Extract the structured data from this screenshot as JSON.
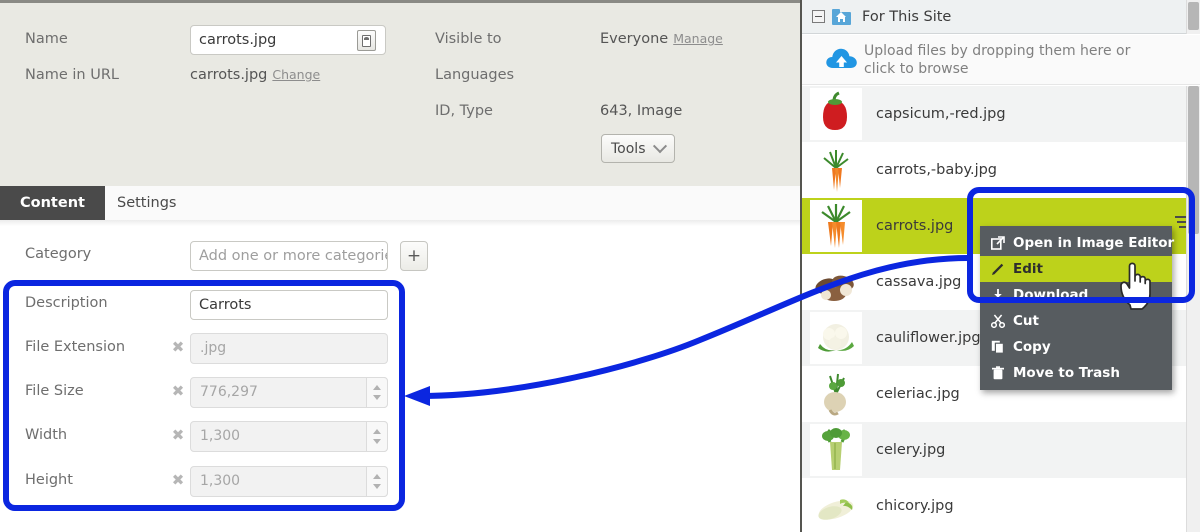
{
  "left": {
    "meta_fields": [
      {
        "label": "Name",
        "value": "carrots.jpg",
        "kind": "input"
      },
      {
        "label": "Name in URL",
        "value": "carrots.jpg",
        "kind": "static",
        "link": "Change"
      },
      {
        "label": "Visible to",
        "value": "Everyone",
        "kind": "static",
        "link": "Manage"
      },
      {
        "label": "Languages",
        "value": "",
        "kind": "static"
      },
      {
        "label": "ID, Type",
        "value": "643, Image",
        "kind": "static"
      }
    ],
    "tools_button": "Tools",
    "tabs": [
      {
        "label": "Content",
        "active": true
      },
      {
        "label": "Settings",
        "active": false
      }
    ],
    "content_fields": [
      {
        "label": "Category",
        "value": "Add one or more categories",
        "placeholder": "Add one or more categories",
        "ghost": true,
        "pin": false,
        "spin": false,
        "plus": true
      },
      {
        "label": "Description",
        "value": "Carrots",
        "placeholder": "",
        "ghost": false,
        "pin": false,
        "spin": false,
        "plus": false
      },
      {
        "label": "File Extension",
        "value": ".jpg",
        "placeholder": ".jpg",
        "ghost": true,
        "pin": true,
        "spin": false,
        "plus": false
      },
      {
        "label": "File Size",
        "value": "776,297",
        "placeholder": "776,297",
        "ghost": true,
        "pin": true,
        "spin": true,
        "plus": false
      },
      {
        "label": "Width",
        "value": "1,300",
        "placeholder": "1,300",
        "ghost": true,
        "pin": true,
        "spin": true,
        "plus": false
      },
      {
        "label": "Height",
        "value": "1,300",
        "placeholder": "1,300",
        "ghost": true,
        "pin": true,
        "spin": true,
        "plus": false
      }
    ]
  },
  "right": {
    "site_title": "For This Site",
    "upload_text": "Upload files by dropping them here or click to browse",
    "files": [
      {
        "name": "capsicum,-red.jpg",
        "thumb": "capsicum",
        "row": "alt",
        "selected": false
      },
      {
        "name": "carrots,-baby.jpg",
        "thumb": "carrots-baby",
        "row": "plain",
        "selected": false
      },
      {
        "name": "carrots.jpg",
        "thumb": "carrots",
        "row": "alt",
        "selected": true
      },
      {
        "name": "cassava.jpg",
        "thumb": "cassava",
        "row": "plain",
        "selected": false
      },
      {
        "name": "cauliflower.jpg",
        "thumb": "cauliflower",
        "row": "alt",
        "selected": false
      },
      {
        "name": "celeriac.jpg",
        "thumb": "celeriac",
        "row": "plain",
        "selected": false
      },
      {
        "name": "celery.jpg",
        "thumb": "celery",
        "row": "alt",
        "selected": false
      },
      {
        "name": "chicory.jpg",
        "thumb": "chicory",
        "row": "plain",
        "selected": false
      }
    ],
    "context_menu": [
      {
        "label": "Open in Image Editor",
        "icon": "external-link-icon",
        "highlighted": false
      },
      {
        "label": "Edit",
        "icon": "pencil-icon",
        "highlighted": true
      },
      {
        "label": "Download",
        "icon": "download-icon",
        "highlighted": false
      },
      {
        "label": "Cut",
        "icon": "scissors-icon",
        "highlighted": false
      },
      {
        "label": "Copy",
        "icon": "copy-icon",
        "highlighted": false
      },
      {
        "label": "Move to Trash",
        "icon": "trash-icon",
        "highlighted": false
      }
    ]
  },
  "colors": {
    "annotation": "#0b26e0",
    "selection": "#bdd21b",
    "tab_active": "#4a4a4a",
    "menu_bg": "#575c60",
    "meta_bg": "#e9e9e3"
  }
}
